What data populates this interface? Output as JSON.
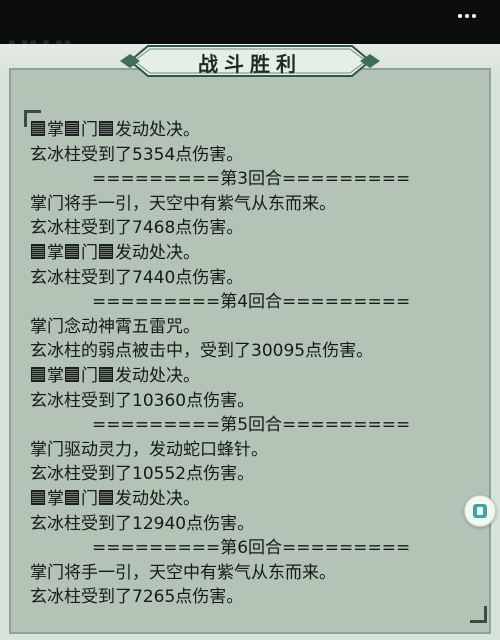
{
  "header": {
    "partial_text": "▪ ▪▪ ▪ ▪▪",
    "menu_icon": "more-dots-icon"
  },
  "title": "战斗胜利",
  "log": [
    {
      "pre": "",
      "mid1": "掌",
      "mid2": "门",
      "text": "发动处决。",
      "type": "masked"
    },
    {
      "text": "玄冰柱受到了5354点伤害。",
      "type": "text"
    },
    {
      "text": "=========第3回合=========",
      "type": "sep"
    },
    {
      "text": "掌门将手一引，天空中有紫气从东而来。",
      "type": "text"
    },
    {
      "text": "玄冰柱受到了7468点伤害。",
      "type": "text"
    },
    {
      "mid1": "掌",
      "mid2": "门",
      "text": "发动处决。",
      "type": "masked"
    },
    {
      "text": "玄冰柱受到了7440点伤害。",
      "type": "text"
    },
    {
      "text": "=========第4回合=========",
      "type": "sep"
    },
    {
      "text": "掌门念动神霄五雷咒。",
      "type": "text"
    },
    {
      "text": "玄冰柱的弱点被击中，受到了30095点伤害。",
      "type": "text"
    },
    {
      "mid1": "掌",
      "mid2": "门",
      "text": "发动处决。",
      "type": "masked"
    },
    {
      "text": "玄冰柱受到了10360点伤害。",
      "type": "text"
    },
    {
      "text": "=========第5回合=========",
      "type": "sep"
    },
    {
      "text": "掌门驱动灵力，发动蛇口蜂针。",
      "type": "text"
    },
    {
      "text": "玄冰柱受到了10552点伤害。",
      "type": "text"
    },
    {
      "mid1": "掌",
      "mid2": "门",
      "text": "发动处决。",
      "type": "masked"
    },
    {
      "text": "玄冰柱受到了12940点伤害。",
      "type": "text"
    },
    {
      "text": "=========第6回合=========",
      "type": "sep"
    },
    {
      "text": "掌门将手一引，天空中有紫气从东而来。",
      "type": "text"
    },
    {
      "text": "玄冰柱受到了7265点伤害。",
      "type": "text"
    }
  ],
  "side_button_icon": "book-icon"
}
